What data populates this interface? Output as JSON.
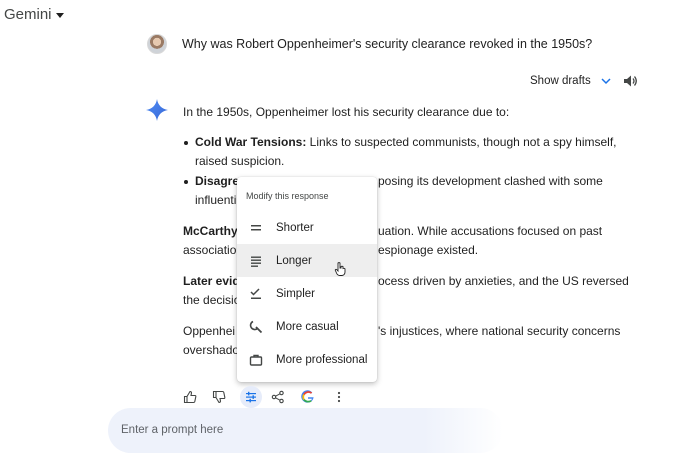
{
  "app": {
    "brand": "Gemini"
  },
  "user_message": "Why was Robert Oppenheimer's security clearance revoked in the 1950s?",
  "toolbar": {
    "show_drafts": "Show drafts"
  },
  "response": {
    "intro": "In the 1950s, Oppenheimer lost his security clearance due to:",
    "bullet1_bold": "Cold War Tensions:",
    "bullet1_text": " Links to suspected communists, though not a spy himself,",
    "bullet1_line2": "raised suspicion.",
    "bullet2_bold": "Disagre",
    "bullet2_tail": "posing its development clashed with some",
    "bullet2_line2": "influenti",
    "para1_bold": "McCarthy",
    "para1_tail": "uation. While accusations focused on past",
    "para1_line2_start": "associatio",
    "para1_line2_tail": "espionage existed.",
    "para2_bold": "Later evid",
    "para2_tail": "ocess driven by anxieties, and the US reversed",
    "para2_line2": "the decisio",
    "para3_start": "Oppenhei",
    "para3_tail": "'s injustices, where national security concerns",
    "para3_line2": "overshado"
  },
  "modify_menu": {
    "header": "Modify this response",
    "items": [
      {
        "label": "Shorter",
        "icon": "short-text-icon"
      },
      {
        "label": "Longer",
        "icon": "long-text-icon"
      },
      {
        "label": "Simpler",
        "icon": "checklist-icon"
      },
      {
        "label": "More casual",
        "icon": "casual-brush-icon"
      },
      {
        "label": "More professional",
        "icon": "briefcase-icon"
      }
    ],
    "highlighted": "Longer"
  },
  "prompt": {
    "placeholder": "Enter a prompt here"
  },
  "colors": {
    "accent_blue": "#4285f4",
    "menu_highlight": "#eeeeee",
    "prompt_bg": "#eef2fb"
  }
}
